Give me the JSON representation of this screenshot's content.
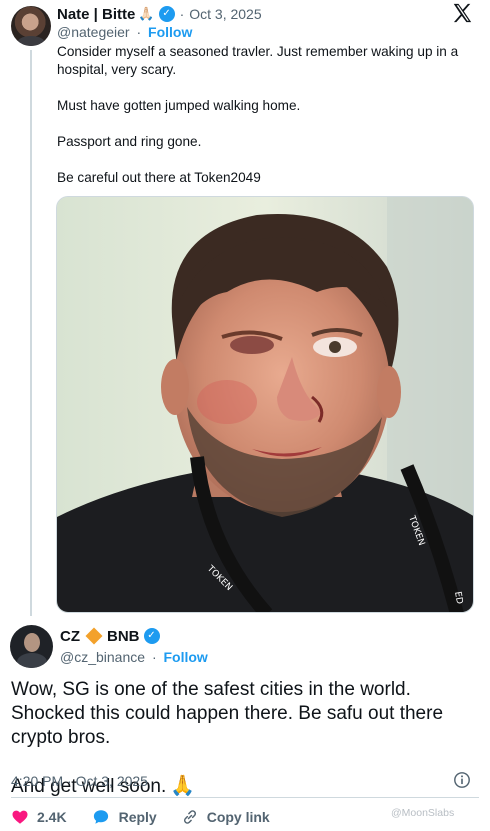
{
  "quoted_tweet": {
    "display_name": "Nate | Bitte",
    "name_emoji": "🙏🏻",
    "date": "Oct 3, 2025",
    "handle": "@nategeier",
    "follow_label": "Follow",
    "text": [
      "Consider myself a seasoned travler. Just remember waking up in a hospital, very scary.",
      "Must have gotten jumped walking home.",
      "Passport and ring gone.",
      "Be careful out there at Token2049"
    ],
    "photo_lanyard_text": [
      "TOKEN",
      "TOKEN",
      "ED"
    ]
  },
  "main_tweet": {
    "display_name": "CZ",
    "name_suffix": "BNB",
    "handle": "@cz_binance",
    "follow_label": "Follow",
    "text": [
      "Wow, SG is one of the safest cities in the world. Shocked this could happen there. Be safu out there crypto bros.",
      "And get well soon."
    ],
    "end_emoji": "🙏",
    "timestamp": "4:20 PM · Oct 3, 2025"
  },
  "actions": {
    "like_count": "2.4K",
    "reply_label": "Reply",
    "copy_link_label": "Copy link"
  },
  "watermark": "@MoonSlabs",
  "icons": {
    "verified": "verified-badge-icon",
    "x_logo": "x-logo-icon",
    "info": "info-icon",
    "like": "heart-icon",
    "reply": "reply-bubble-icon",
    "copy_link": "link-icon",
    "bnb": "bnb-diamond-icon"
  },
  "colors": {
    "accent_blue": "#1d9bf0",
    "like_pink": "#f91880",
    "text_primary": "#0f1419",
    "text_secondary": "#536471",
    "bnb_orange": "#f3a12b"
  }
}
